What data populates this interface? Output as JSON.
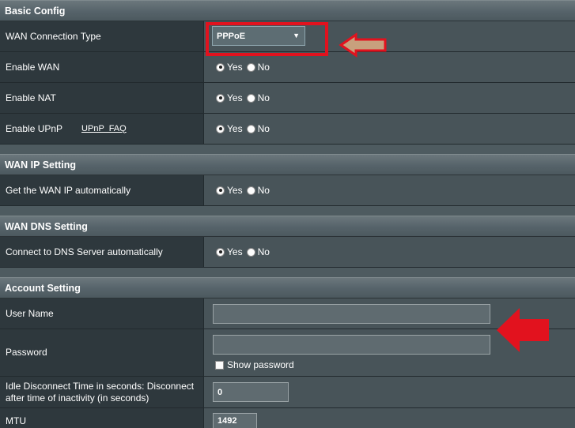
{
  "sections": {
    "basic": "Basic Config",
    "wan_ip": "WAN IP Setting",
    "wan_dns": "WAN DNS Setting",
    "account": "Account Setting"
  },
  "basic_config": {
    "wan_connection_type_label": "WAN Connection Type",
    "wan_connection_type_value": "PPPoE",
    "enable_wan_label": "Enable WAN",
    "enable_nat_label": "Enable NAT",
    "enable_upnp_label": "Enable UPnP",
    "upnp_faq_link": "UPnP  FAQ"
  },
  "radio": {
    "yes": "Yes",
    "no": "No"
  },
  "wan_ip_setting": {
    "get_ip_auto_label": "Get the WAN IP automatically"
  },
  "wan_dns_setting": {
    "dns_auto_label": "Connect to DNS Server automatically"
  },
  "account_setting": {
    "username_label": "User Name",
    "username_value": "",
    "password_label": "Password",
    "password_value": "",
    "show_password_label": "Show password",
    "idle_label": "Idle Disconnect Time in seconds: Disconnect after time of inactivity (in seconds)",
    "idle_value": "0",
    "mtu_label": "MTU",
    "mtu_value": "1492"
  },
  "colors": {
    "highlight_red": "#e2121e",
    "arrow_tan": "#c8a07d"
  },
  "icons": {
    "dropdown": "chevron-down-icon",
    "annotation": "arrow-left-icon"
  }
}
